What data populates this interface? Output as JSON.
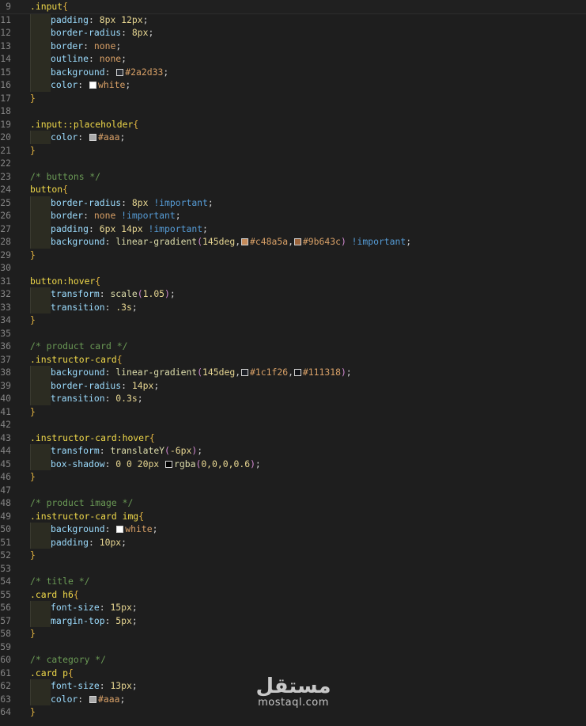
{
  "editor": {
    "lines": [
      {
        "n": "9",
        "sticky": true,
        "indent": 0,
        "tokens": [
          {
            "t": ".input",
            "c": "sel"
          },
          {
            "t": "{",
            "c": "brace"
          }
        ]
      },
      {
        "n": "11",
        "indent": 1,
        "tokens": [
          {
            "t": "padding",
            "c": "prop"
          },
          {
            "t": ": ",
            "c": "punc"
          },
          {
            "t": "8px 12px",
            "c": "num"
          },
          {
            "t": ";",
            "c": "punc"
          }
        ]
      },
      {
        "n": "12",
        "indent": 1,
        "tokens": [
          {
            "t": "border-radius",
            "c": "prop"
          },
          {
            "t": ": ",
            "c": "punc"
          },
          {
            "t": "8px",
            "c": "num"
          },
          {
            "t": ";",
            "c": "punc"
          }
        ]
      },
      {
        "n": "13",
        "indent": 1,
        "tokens": [
          {
            "t": "border",
            "c": "prop"
          },
          {
            "t": ": ",
            "c": "punc"
          },
          {
            "t": "none",
            "c": "kw"
          },
          {
            "t": ";",
            "c": "punc"
          }
        ]
      },
      {
        "n": "14",
        "indent": 1,
        "tokens": [
          {
            "t": "outline",
            "c": "prop"
          },
          {
            "t": ": ",
            "c": "punc"
          },
          {
            "t": "none",
            "c": "kw"
          },
          {
            "t": ";",
            "c": "punc"
          }
        ]
      },
      {
        "n": "15",
        "indent": 1,
        "tokens": [
          {
            "t": "background",
            "c": "prop"
          },
          {
            "t": ": ",
            "c": "punc"
          },
          {
            "sw": "#2a2d33"
          },
          {
            "t": "#2a2d33",
            "c": "str"
          },
          {
            "t": ";",
            "c": "punc"
          }
        ]
      },
      {
        "n": "16",
        "indent": 1,
        "tokens": [
          {
            "t": "color",
            "c": "prop"
          },
          {
            "t": ": ",
            "c": "punc"
          },
          {
            "sw": "#ffffff"
          },
          {
            "t": "white",
            "c": "str"
          },
          {
            "t": ";",
            "c": "punc"
          }
        ]
      },
      {
        "n": "17",
        "indent": 0,
        "tokens": [
          {
            "t": "}",
            "c": "brace"
          }
        ]
      },
      {
        "n": "18",
        "indent": 0,
        "tokens": []
      },
      {
        "n": "19",
        "indent": 0,
        "tokens": [
          {
            "t": ".input::placeholder",
            "c": "sel"
          },
          {
            "t": "{",
            "c": "brace"
          }
        ]
      },
      {
        "n": "20",
        "indent": 1,
        "tokens": [
          {
            "t": "color",
            "c": "prop"
          },
          {
            "t": ": ",
            "c": "punc"
          },
          {
            "sw": "#aaaaaa"
          },
          {
            "t": "#aaa",
            "c": "str"
          },
          {
            "t": ";",
            "c": "punc"
          }
        ]
      },
      {
        "n": "21",
        "indent": 0,
        "tokens": [
          {
            "t": "}",
            "c": "brace"
          }
        ]
      },
      {
        "n": "22",
        "indent": 0,
        "tokens": []
      },
      {
        "n": "23",
        "indent": 0,
        "tokens": [
          {
            "t": "/* buttons */",
            "c": "com"
          }
        ]
      },
      {
        "n": "24",
        "indent": 0,
        "tokens": [
          {
            "t": "button",
            "c": "sel"
          },
          {
            "t": "{",
            "c": "brace"
          }
        ]
      },
      {
        "n": "25",
        "indent": 1,
        "tokens": [
          {
            "t": "border-radius",
            "c": "prop"
          },
          {
            "t": ": ",
            "c": "punc"
          },
          {
            "t": "8px",
            "c": "num"
          },
          {
            "t": " ",
            "c": "punc"
          },
          {
            "t": "!important",
            "c": "imp"
          },
          {
            "t": ";",
            "c": "punc"
          }
        ]
      },
      {
        "n": "26",
        "indent": 1,
        "tokens": [
          {
            "t": "border",
            "c": "prop"
          },
          {
            "t": ": ",
            "c": "punc"
          },
          {
            "t": "none",
            "c": "kw"
          },
          {
            "t": " ",
            "c": "punc"
          },
          {
            "t": "!important",
            "c": "imp"
          },
          {
            "t": ";",
            "c": "punc"
          }
        ]
      },
      {
        "n": "27",
        "indent": 1,
        "tokens": [
          {
            "t": "padding",
            "c": "prop"
          },
          {
            "t": ": ",
            "c": "punc"
          },
          {
            "t": "6px 14px",
            "c": "num"
          },
          {
            "t": " ",
            "c": "punc"
          },
          {
            "t": "!important",
            "c": "imp"
          },
          {
            "t": ";",
            "c": "punc"
          }
        ]
      },
      {
        "n": "28",
        "indent": 1,
        "tokens": [
          {
            "t": "background",
            "c": "prop"
          },
          {
            "t": ": ",
            "c": "punc"
          },
          {
            "t": "linear-gradient",
            "c": "fn"
          },
          {
            "t": "(",
            "c": "paren"
          },
          {
            "t": "145deg",
            "c": "num"
          },
          {
            "t": ",",
            "c": "punc"
          },
          {
            "sw": "#c48a5a"
          },
          {
            "t": "#c48a5a",
            "c": "str"
          },
          {
            "t": ",",
            "c": "punc"
          },
          {
            "sw": "#9b643c"
          },
          {
            "t": "#9b643c",
            "c": "str"
          },
          {
            "t": ")",
            "c": "paren"
          },
          {
            "t": " ",
            "c": "punc"
          },
          {
            "t": "!important",
            "c": "imp"
          },
          {
            "t": ";",
            "c": "punc"
          }
        ]
      },
      {
        "n": "29",
        "indent": 0,
        "tokens": [
          {
            "t": "}",
            "c": "brace"
          }
        ]
      },
      {
        "n": "30",
        "indent": 0,
        "tokens": []
      },
      {
        "n": "31",
        "indent": 0,
        "tokens": [
          {
            "t": "button:hover",
            "c": "sel"
          },
          {
            "t": "{",
            "c": "brace"
          }
        ]
      },
      {
        "n": "32",
        "indent": 1,
        "tokens": [
          {
            "t": "transform",
            "c": "prop"
          },
          {
            "t": ": ",
            "c": "punc"
          },
          {
            "t": "scale",
            "c": "fn"
          },
          {
            "t": "(",
            "c": "paren"
          },
          {
            "t": "1.05",
            "c": "num"
          },
          {
            "t": ")",
            "c": "paren"
          },
          {
            "t": ";",
            "c": "punc"
          }
        ]
      },
      {
        "n": "33",
        "indent": 1,
        "tokens": [
          {
            "t": "transition",
            "c": "prop"
          },
          {
            "t": ": ",
            "c": "punc"
          },
          {
            "t": ".3s",
            "c": "num"
          },
          {
            "t": ";",
            "c": "punc"
          }
        ]
      },
      {
        "n": "34",
        "indent": 0,
        "tokens": [
          {
            "t": "}",
            "c": "brace"
          }
        ]
      },
      {
        "n": "35",
        "indent": 0,
        "tokens": []
      },
      {
        "n": "36",
        "indent": 0,
        "tokens": [
          {
            "t": "/* product card */",
            "c": "com"
          }
        ]
      },
      {
        "n": "37",
        "indent": 0,
        "tokens": [
          {
            "t": ".instructor-card",
            "c": "sel"
          },
          {
            "t": "{",
            "c": "brace"
          }
        ]
      },
      {
        "n": "38",
        "indent": 1,
        "tokens": [
          {
            "t": "background",
            "c": "prop"
          },
          {
            "t": ": ",
            "c": "punc"
          },
          {
            "t": "linear-gradient",
            "c": "fn"
          },
          {
            "t": "(",
            "c": "paren"
          },
          {
            "t": "145deg",
            "c": "num"
          },
          {
            "t": ",",
            "c": "punc"
          },
          {
            "sw": "#1c1f26"
          },
          {
            "t": "#1c1f26",
            "c": "str"
          },
          {
            "t": ",",
            "c": "punc"
          },
          {
            "sw": "#111318"
          },
          {
            "t": "#111318",
            "c": "str"
          },
          {
            "t": ")",
            "c": "paren"
          },
          {
            "t": ";",
            "c": "punc"
          }
        ]
      },
      {
        "n": "39",
        "indent": 1,
        "tokens": [
          {
            "t": "border-radius",
            "c": "prop"
          },
          {
            "t": ": ",
            "c": "punc"
          },
          {
            "t": "14px",
            "c": "num"
          },
          {
            "t": ";",
            "c": "punc"
          }
        ]
      },
      {
        "n": "40",
        "indent": 1,
        "tokens": [
          {
            "t": "transition",
            "c": "prop"
          },
          {
            "t": ": ",
            "c": "punc"
          },
          {
            "t": "0.3s",
            "c": "num"
          },
          {
            "t": ";",
            "c": "punc"
          }
        ]
      },
      {
        "n": "41",
        "indent": 0,
        "tokens": [
          {
            "t": "}",
            "c": "brace"
          }
        ]
      },
      {
        "n": "42",
        "indent": 0,
        "tokens": []
      },
      {
        "n": "43",
        "indent": 0,
        "tokens": [
          {
            "t": ".instructor-card:hover",
            "c": "sel"
          },
          {
            "t": "{",
            "c": "brace"
          }
        ]
      },
      {
        "n": "44",
        "indent": 1,
        "tokens": [
          {
            "t": "transform",
            "c": "prop"
          },
          {
            "t": ": ",
            "c": "punc"
          },
          {
            "t": "translateY",
            "c": "fn"
          },
          {
            "t": "(",
            "c": "paren"
          },
          {
            "t": "-6px",
            "c": "num"
          },
          {
            "t": ")",
            "c": "paren"
          },
          {
            "t": ";",
            "c": "punc"
          }
        ]
      },
      {
        "n": "45",
        "indent": 1,
        "tokens": [
          {
            "t": "box-shadow",
            "c": "prop"
          },
          {
            "t": ": ",
            "c": "punc"
          },
          {
            "t": "0 0 20px ",
            "c": "num"
          },
          {
            "sw": "#000000"
          },
          {
            "t": "rgba",
            "c": "fn"
          },
          {
            "t": "(",
            "c": "paren"
          },
          {
            "t": "0,0,0,0.6",
            "c": "num"
          },
          {
            "t": ")",
            "c": "paren"
          },
          {
            "t": ";",
            "c": "punc"
          }
        ]
      },
      {
        "n": "46",
        "indent": 0,
        "tokens": [
          {
            "t": "}",
            "c": "brace"
          }
        ]
      },
      {
        "n": "47",
        "indent": 0,
        "tokens": []
      },
      {
        "n": "48",
        "indent": 0,
        "tokens": [
          {
            "t": "/* product image */",
            "c": "com"
          }
        ]
      },
      {
        "n": "49",
        "indent": 0,
        "tokens": [
          {
            "t": ".instructor-card img",
            "c": "sel"
          },
          {
            "t": "{",
            "c": "brace"
          }
        ]
      },
      {
        "n": "50",
        "indent": 1,
        "tokens": [
          {
            "t": "background",
            "c": "prop"
          },
          {
            "t": ": ",
            "c": "punc"
          },
          {
            "sw": "#ffffff"
          },
          {
            "t": "white",
            "c": "str"
          },
          {
            "t": ";",
            "c": "punc"
          }
        ]
      },
      {
        "n": "51",
        "indent": 1,
        "tokens": [
          {
            "t": "padding",
            "c": "prop"
          },
          {
            "t": ": ",
            "c": "punc"
          },
          {
            "t": "10px",
            "c": "num"
          },
          {
            "t": ";",
            "c": "punc"
          }
        ]
      },
      {
        "n": "52",
        "indent": 0,
        "tokens": [
          {
            "t": "}",
            "c": "brace"
          }
        ]
      },
      {
        "n": "53",
        "indent": 0,
        "tokens": []
      },
      {
        "n": "54",
        "indent": 0,
        "tokens": [
          {
            "t": "/* title */",
            "c": "com"
          }
        ]
      },
      {
        "n": "55",
        "indent": 0,
        "tokens": [
          {
            "t": ".card h6",
            "c": "sel"
          },
          {
            "t": "{",
            "c": "brace"
          }
        ]
      },
      {
        "n": "56",
        "indent": 1,
        "tokens": [
          {
            "t": "font-size",
            "c": "prop"
          },
          {
            "t": ": ",
            "c": "punc"
          },
          {
            "t": "15px",
            "c": "num"
          },
          {
            "t": ";",
            "c": "punc"
          }
        ]
      },
      {
        "n": "57",
        "indent": 1,
        "tokens": [
          {
            "t": "margin-top",
            "c": "prop"
          },
          {
            "t": ": ",
            "c": "punc"
          },
          {
            "t": "5px",
            "c": "num"
          },
          {
            "t": ";",
            "c": "punc"
          }
        ]
      },
      {
        "n": "58",
        "indent": 0,
        "tokens": [
          {
            "t": "}",
            "c": "brace"
          }
        ]
      },
      {
        "n": "59",
        "indent": 0,
        "tokens": []
      },
      {
        "n": "60",
        "indent": 0,
        "tokens": [
          {
            "t": "/* category */",
            "c": "com"
          }
        ]
      },
      {
        "n": "61",
        "indent": 0,
        "tokens": [
          {
            "t": ".card p",
            "c": "sel"
          },
          {
            "t": "{",
            "c": "brace"
          }
        ]
      },
      {
        "n": "62",
        "indent": 1,
        "tokens": [
          {
            "t": "font-size",
            "c": "prop"
          },
          {
            "t": ": ",
            "c": "punc"
          },
          {
            "t": "13px",
            "c": "num"
          },
          {
            "t": ";",
            "c": "punc"
          }
        ]
      },
      {
        "n": "63",
        "indent": 1,
        "tokens": [
          {
            "t": "color",
            "c": "prop"
          },
          {
            "t": ": ",
            "c": "punc"
          },
          {
            "sw": "#aaaaaa"
          },
          {
            "t": "#aaa",
            "c": "str"
          },
          {
            "t": ";",
            "c": "punc"
          }
        ]
      },
      {
        "n": "64",
        "indent": 0,
        "tokens": [
          {
            "t": "}",
            "c": "brace"
          }
        ]
      }
    ]
  },
  "watermark": {
    "arabic": "مستقل",
    "latin": "mostaql.com"
  }
}
